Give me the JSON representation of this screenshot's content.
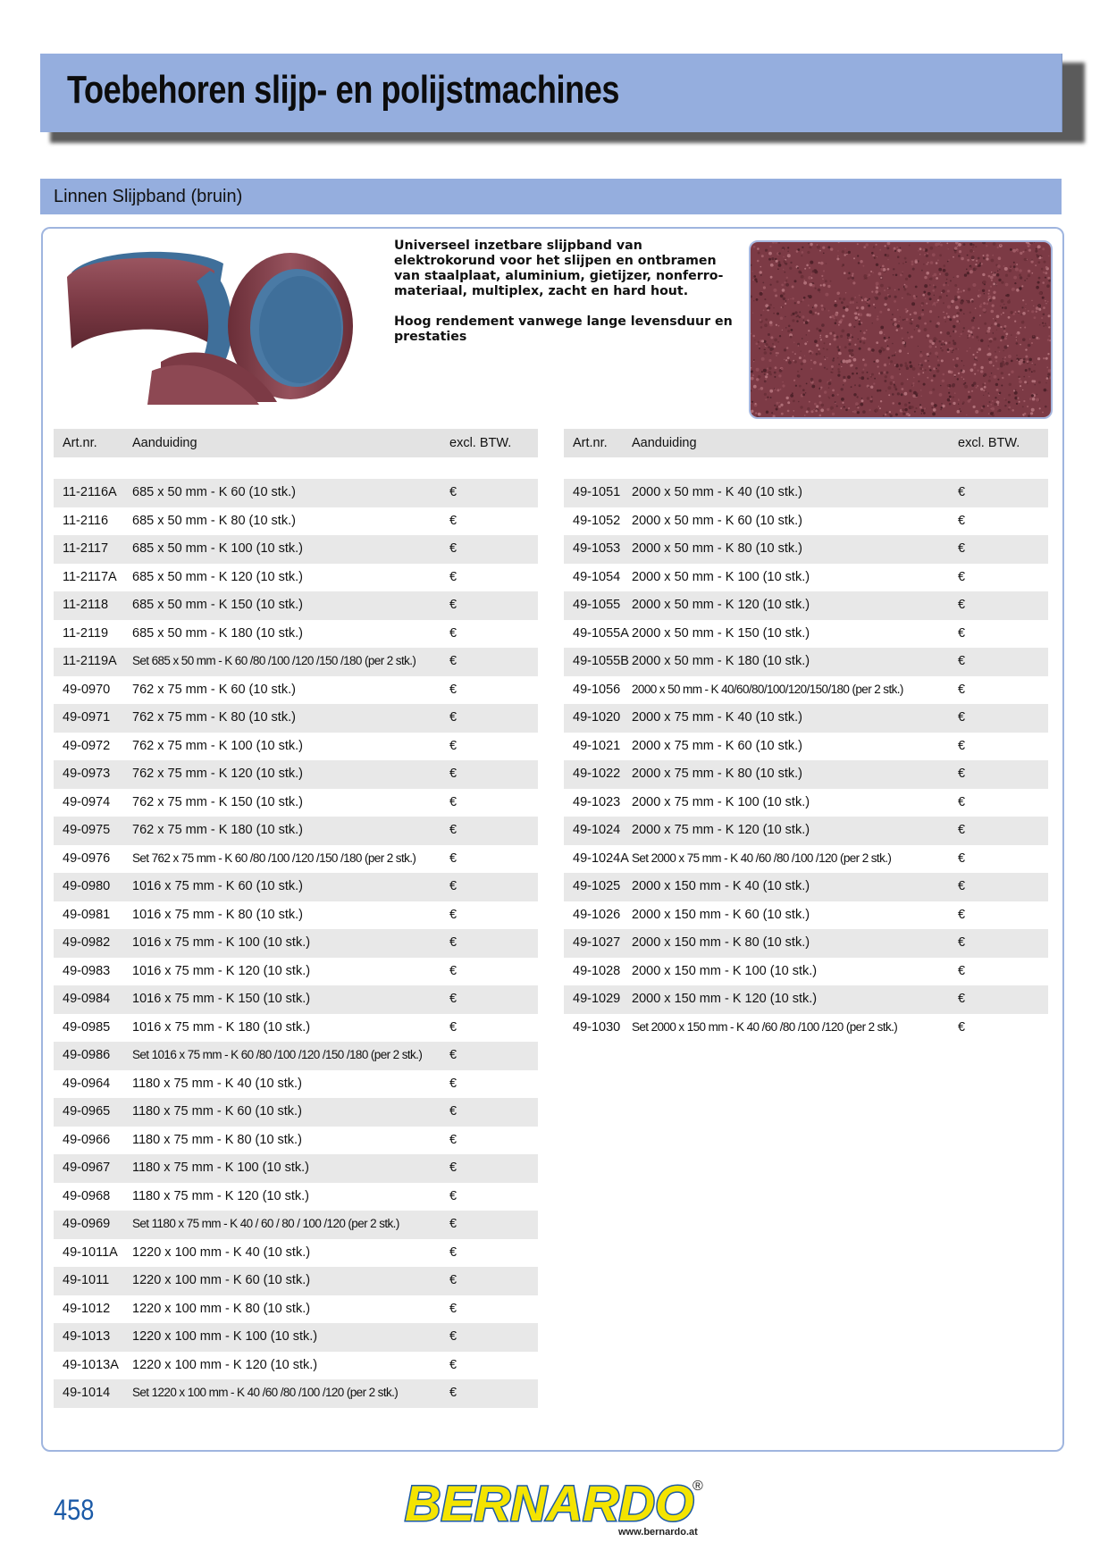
{
  "header": {
    "title": "Toebehoren slijp- en polijstmachines",
    "section": "Linnen Slijpband (bruin)"
  },
  "description": {
    "p1": "Universeel inzetbare slijpband van elektrokorund voor het slijpen en ontbramen van staalplaat, aluminium, gietijzer, nonferro-materiaal, multiplex, zacht en hard hout.",
    "p2": "Hoog rendement vanwege lange levensduur en prestaties"
  },
  "table_headers": {
    "art": "Art.nr.",
    "desc": "Aanduiding",
    "price": "excl. BTW."
  },
  "left_rows": [
    {
      "art": "11-2116A",
      "desc": "685 x 50 mm - K 60 (10 stk.)",
      "price": "€"
    },
    {
      "art": "11-2116",
      "desc": "685 x 50 mm - K 80 (10 stk.)",
      "price": "€"
    },
    {
      "art": "11-2117",
      "desc": "685 x 50 mm - K 100 (10 stk.)",
      "price": "€"
    },
    {
      "art": "11-2117A",
      "desc": "685 x 50 mm - K 120 (10 stk.)",
      "price": "€"
    },
    {
      "art": "11-2118",
      "desc": "685 x 50 mm - K 150 (10 stk.)",
      "price": "€"
    },
    {
      "art": "11-2119",
      "desc": "685 x 50 mm - K 180 (10 stk.)",
      "price": "€"
    },
    {
      "art": "11-2119A",
      "desc": "Set 685 x 50 mm - K 60 /80 /100 /120 /150 /180 (per 2 stk.)",
      "price": "€"
    },
    {
      "art": "49-0970",
      "desc": "762 x 75 mm - K 60 (10 stk.)",
      "price": "€"
    },
    {
      "art": "49-0971",
      "desc": "762 x 75 mm - K 80 (10 stk.)",
      "price": "€"
    },
    {
      "art": "49-0972",
      "desc": "762 x 75 mm - K 100 (10 stk.)",
      "price": "€"
    },
    {
      "art": "49-0973",
      "desc": "762 x 75 mm - K 120 (10 stk.)",
      "price": "€"
    },
    {
      "art": "49-0974",
      "desc": "762 x 75 mm - K 150 (10 stk.)",
      "price": "€"
    },
    {
      "art": "49-0975",
      "desc": "762 x 75 mm - K 180 (10 stk.)",
      "price": "€"
    },
    {
      "art": "49-0976",
      "desc": "Set 762 x 75 mm - K 60 /80 /100 /120 /150 /180 (per 2 stk.)",
      "price": "€"
    },
    {
      "art": "49-0980",
      "desc": "1016 x 75 mm - K 60 (10 stk.)",
      "price": "€"
    },
    {
      "art": "49-0981",
      "desc": "1016 x 75 mm - K 80 (10 stk.)",
      "price": "€"
    },
    {
      "art": "49-0982",
      "desc": "1016 x 75 mm - K 100 (10 stk.)",
      "price": "€"
    },
    {
      "art": "49-0983",
      "desc": "1016 x 75 mm - K 120 (10 stk.)",
      "price": "€"
    },
    {
      "art": "49-0984",
      "desc": "1016 x 75 mm - K 150 (10 stk.)",
      "price": "€"
    },
    {
      "art": "49-0985",
      "desc": "1016 x 75 mm - K 180 (10 stk.)",
      "price": "€"
    },
    {
      "art": "49-0986",
      "desc": "Set 1016 x 75 mm - K 60 /80 /100 /120 /150 /180 (per 2 stk.)",
      "price": "€"
    },
    {
      "art": "49-0964",
      "desc": "1180 x 75 mm - K 40 (10 stk.)",
      "price": "€"
    },
    {
      "art": "49-0965",
      "desc": "1180 x 75 mm - K 60 (10 stk.)",
      "price": "€"
    },
    {
      "art": "49-0966",
      "desc": "1180 x 75 mm - K 80 (10 stk.)",
      "price": "€"
    },
    {
      "art": "49-0967",
      "desc": "1180 x 75 mm - K 100 (10 stk.)",
      "price": "€"
    },
    {
      "art": "49-0968",
      "desc": "1180 x 75 mm - K 120 (10 stk.)",
      "price": "€"
    },
    {
      "art": "49-0969",
      "desc": "Set 1180 x 75 mm - K 40 / 60 / 80 / 100 /120 (per 2 stk.)",
      "price": "€"
    },
    {
      "art": "49-1011A",
      "desc": "1220 x 100 mm - K 40 (10 stk.)",
      "price": "€"
    },
    {
      "art": "49-1011",
      "desc": "1220 x 100 mm - K 60 (10 stk.)",
      "price": "€"
    },
    {
      "art": "49-1012",
      "desc": "1220 x 100 mm - K 80 (10 stk.)",
      "price": "€"
    },
    {
      "art": "49-1013",
      "desc": "1220 x 100 mm - K 100 (10 stk.)",
      "price": "€"
    },
    {
      "art": "49-1013A",
      "desc": "1220 x 100 mm - K 120 (10 stk.)",
      "price": "€"
    },
    {
      "art": "49-1014",
      "desc": "Set 1220 x 100 mm - K 40 /60 /80 /100 /120 (per 2 stk.)",
      "price": "€"
    }
  ],
  "right_rows": [
    {
      "art": "49-1051",
      "desc": "2000 x 50 mm - K 40 (10 stk.)",
      "price": "€"
    },
    {
      "art": "49-1052",
      "desc": "2000 x 50 mm - K 60 (10 stk.)",
      "price": "€"
    },
    {
      "art": "49-1053",
      "desc": "2000 x 50 mm - K 80 (10 stk.)",
      "price": "€"
    },
    {
      "art": "49-1054",
      "desc": "2000 x 50 mm - K 100 (10 stk.)",
      "price": "€"
    },
    {
      "art": "49-1055",
      "desc": "2000 x 50 mm - K 120 (10 stk.)",
      "price": "€"
    },
    {
      "art": "49-1055A",
      "desc": "2000 x 50 mm - K 150 (10 stk.)",
      "price": "€"
    },
    {
      "art": "49-1055B",
      "desc": "2000 x 50 mm - K 180 (10 stk.)",
      "price": "€"
    },
    {
      "art": "49-1056",
      "desc": "2000 x 50 mm - K 40/60/80/100/120/150/180 (per 2 stk.)",
      "price": "€"
    },
    {
      "art": "49-1020",
      "desc": "2000 x 75 mm - K 40 (10 stk.)",
      "price": "€"
    },
    {
      "art": "49-1021",
      "desc": "2000 x 75 mm - K 60 (10 stk.)",
      "price": "€"
    },
    {
      "art": "49-1022",
      "desc": "2000 x 75 mm - K 80 (10 stk.)",
      "price": "€"
    },
    {
      "art": "49-1023",
      "desc": "2000 x 75 mm - K 100 (10 stk.)",
      "price": "€"
    },
    {
      "art": "49-1024",
      "desc": "2000 x 75 mm - K 120 (10 stk.)",
      "price": "€"
    },
    {
      "art": "49-1024A",
      "desc": "Set 2000 x 75 mm - K 40 /60 /80 /100 /120 (per 2 stk.)",
      "price": "€"
    },
    {
      "art": "49-1025",
      "desc": "2000 x 150 mm - K 40 (10 stk.)",
      "price": "€"
    },
    {
      "art": "49-1026",
      "desc": "2000 x 150 mm - K 60 (10 stk.)",
      "price": "€"
    },
    {
      "art": "49-1027",
      "desc": "2000 x 150 mm - K 80 (10 stk.)",
      "price": "€"
    },
    {
      "art": "49-1028",
      "desc": "2000 x 150 mm - K 100 (10 stk.)",
      "price": "€"
    },
    {
      "art": "49-1029",
      "desc": "2000 x 150 mm - K 120 (10 stk.)",
      "price": "€"
    },
    {
      "art": "49-1030",
      "desc": "Set 2000 x 150 mm - K 40 /60 /80 /100 /120 (per 2 stk.)",
      "price": "€"
    }
  ],
  "footer": {
    "page_number": "458",
    "logo_text": "BERNARDO",
    "registered": "®",
    "url": "www.bernardo.at"
  },
  "colors": {
    "header_blue": "#95aede",
    "belt_brown": "#7c3a45",
    "belt_back": "#3f6f9a",
    "logo_yellow": "#f4e400",
    "logo_blue": "#1b5aa7",
    "row_shade": "#e8e8e8"
  }
}
